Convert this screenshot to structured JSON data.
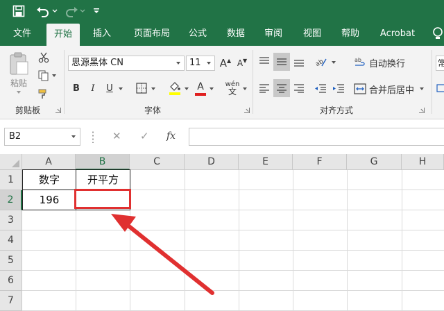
{
  "quick_access": {
    "icons": [
      "save-icon",
      "undo-icon",
      "undo-dropdown-icon",
      "redo-icon",
      "redo-dropdown-icon",
      "customize-qat-icon"
    ]
  },
  "tabs": [
    {
      "label": "文件",
      "active": false
    },
    {
      "label": "开始",
      "active": true
    },
    {
      "label": "插入",
      "active": false
    },
    {
      "label": "页面布局",
      "active": false
    },
    {
      "label": "公式",
      "active": false
    },
    {
      "label": "数据",
      "active": false
    },
    {
      "label": "审阅",
      "active": false
    },
    {
      "label": "视图",
      "active": false
    },
    {
      "label": "帮助",
      "active": false
    },
    {
      "label": "Acrobat",
      "active": false
    }
  ],
  "ribbon": {
    "clipboard": {
      "group_label": "剪贴板",
      "paste_label": "粘贴"
    },
    "font": {
      "group_label": "字体",
      "font_name": "思源黑体 CN",
      "font_size": "11",
      "grow_font": "A",
      "shrink_font": "A",
      "bold": "B",
      "italic": "I",
      "underline": "U",
      "font_color_letter": "A",
      "phonetic": "wén"
    },
    "alignment": {
      "group_label": "对齐方式",
      "wrap_text": "自动换行",
      "merge_center": "合并后居中"
    },
    "number": {
      "partial_label": "常"
    }
  },
  "formula_bar": {
    "name_box": "B2",
    "cancel": "✕",
    "enter": "✓",
    "fx": "fx",
    "content": ""
  },
  "sheet": {
    "columns": [
      "A",
      "B",
      "C",
      "D",
      "E",
      "F",
      "G",
      "H"
    ],
    "rows": [
      "1",
      "2",
      "3",
      "4",
      "5",
      "6",
      "7"
    ],
    "selected_cell": "B2",
    "cells": {
      "A1": "数字",
      "B1": "开平方",
      "A2": "196",
      "B2": ""
    }
  },
  "colors": {
    "excel_green": "#217346",
    "ribbon_bg": "#f3f3f3",
    "annotation_red": "#e03030",
    "font_color_bar": "#e02020",
    "highlight_bar": "#ffff00"
  }
}
